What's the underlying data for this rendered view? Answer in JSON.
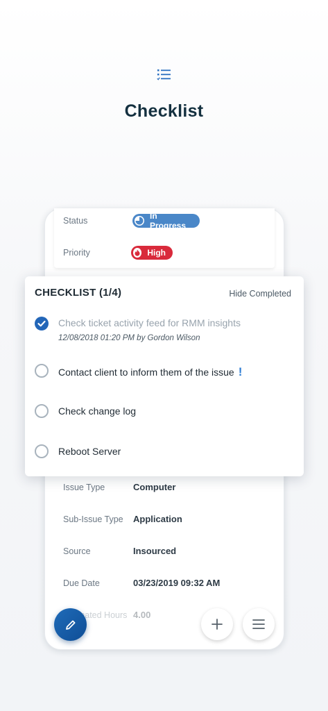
{
  "hero": {
    "title": "Checklist",
    "icon": "checklist-icon"
  },
  "ticket": {
    "status_label": "Status",
    "status_value": "In Progress",
    "priority_label": "Priority",
    "priority_value": "High",
    "fields": [
      {
        "label": "Issue Type",
        "value": "Computer"
      },
      {
        "label": "Sub-Issue Type",
        "value": "Application"
      },
      {
        "label": "Source",
        "value": "Insourced"
      },
      {
        "label": "Due Date",
        "value": "03/23/2019 09:32 AM"
      },
      {
        "label": "Estimated Hours",
        "value": "4.00"
      }
    ]
  },
  "checklist": {
    "title": "CHECKLIST (1/4)",
    "hide_label": "Hide Completed",
    "items": [
      {
        "text": "Check ticket activity feed for RMM insights",
        "done": true,
        "meta": "12/08/2018 01:20 PM by Gordon Wilson"
      },
      {
        "text": "Contact client to inform them of the issue",
        "done": false,
        "important": "!"
      },
      {
        "text": "Check change log",
        "done": false
      },
      {
        "text": "Reboot Server",
        "done": false
      }
    ]
  },
  "colors": {
    "accent": "#2366b8",
    "status_in_progress": "#4a87c8",
    "priority_high": "#d92a3b"
  }
}
